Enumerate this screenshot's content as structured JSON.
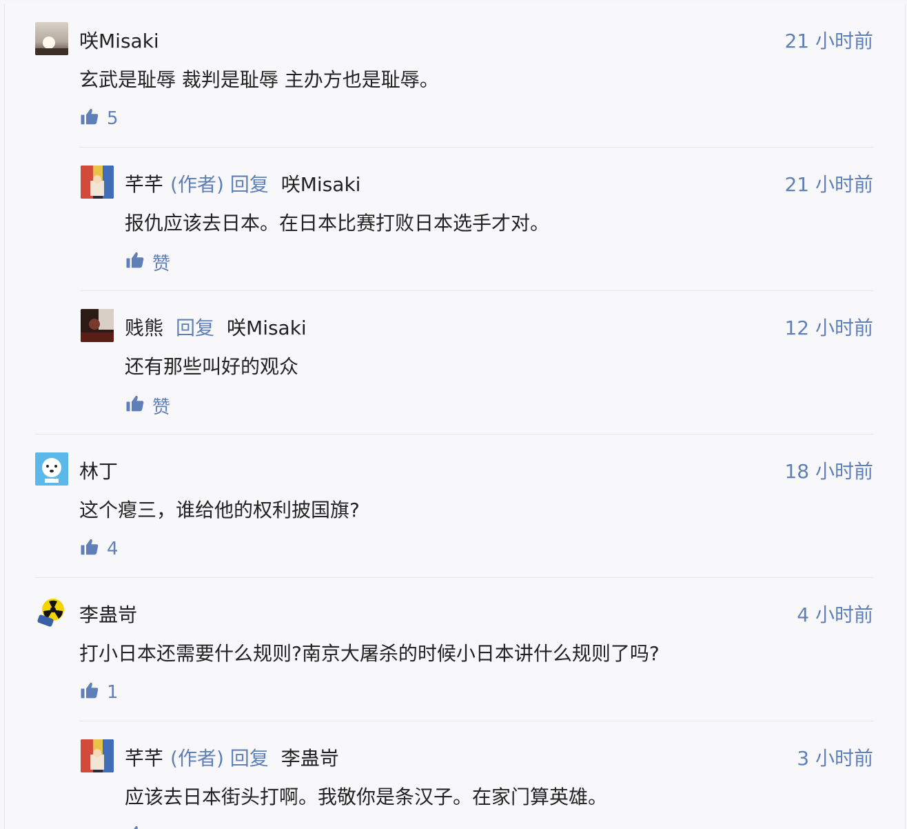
{
  "colors": {
    "accent": "#5f7fb8"
  },
  "comments": [
    {
      "name": "咲Misaki",
      "tag": "",
      "target": "",
      "time": "21 小时前",
      "text": "玄武是耻辱 裁判是耻辱 主办方也是耻辱。",
      "like": "5",
      "avatar": "sunset-avatar"
    },
    {
      "name": "芊芊",
      "tag": "(作者) 回复",
      "target": "咲Misaki",
      "time": "21 小时前",
      "text": "报仇应该去日本。在日本比赛打败日本选手才对。",
      "like": "赞",
      "avatar": "colorful-avatar"
    },
    {
      "name": "贱熊",
      "tag": "回复",
      "target": "咲Misaki",
      "time": "12 小时前",
      "text": "还有那些叫好的观众",
      "like": "赞",
      "avatar": "dark-photo-avatar"
    },
    {
      "name": "林丁",
      "tag": "",
      "target": "",
      "time": "18 小时前",
      "text": "这个瘪三，谁给他的权利披国旗?",
      "like": "4",
      "avatar": "blue-cartoon-avatar"
    },
    {
      "name": "李蛊岢",
      "tag": "",
      "target": "",
      "time": "4 小时前",
      "text": "打小日本还需要什么规则?南京大屠杀的时候小日本讲什么规则了吗?",
      "like": "1",
      "avatar": "radiation-avatar"
    },
    {
      "name": "芊芊",
      "tag": "(作者) 回复",
      "target": "李蛊岢",
      "time": "3 小时前",
      "text": "应该去日本街头打啊。我敬你是条汉子。在家门算英雄。",
      "like": "",
      "avatar": "colorful-avatar"
    }
  ]
}
